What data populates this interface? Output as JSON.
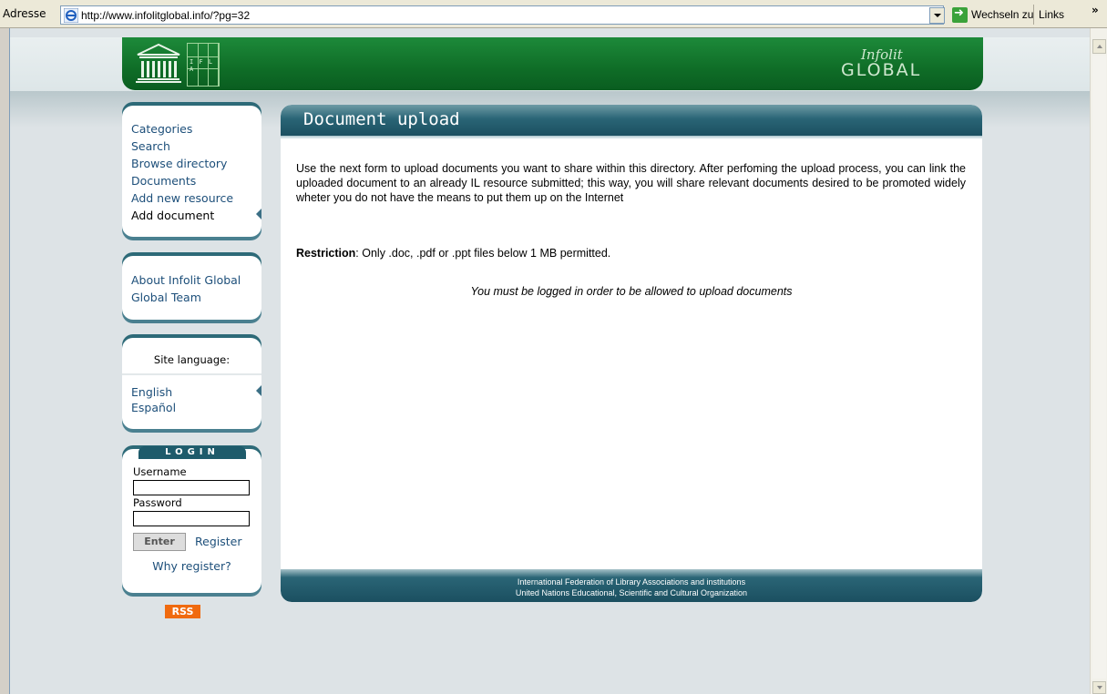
{
  "browser": {
    "address_label": "Adresse",
    "url": "http://www.infolitglobal.info/?pg=32",
    "go_label": "Wechseln zu",
    "links_label": "Links",
    "chevron": "»"
  },
  "logos": {
    "ifla": "I F L A",
    "infolit_top": "Infolit",
    "infolit_bottom": "GLOBAL"
  },
  "nav": {
    "items": [
      "Categories",
      "Search",
      "Browse directory",
      "Documents",
      "Add new resource",
      "Add document"
    ],
    "active_index": 5
  },
  "about": {
    "items": [
      "About Infolit Global",
      "Global Team"
    ]
  },
  "language": {
    "title": "Site language:",
    "items": [
      "English",
      "Español"
    ]
  },
  "login": {
    "heading": "LOGIN",
    "username_label": "Username",
    "password_label": "Password",
    "enter_label": "Enter",
    "register_label": "Register",
    "why_label": "Why register?"
  },
  "rss_label": "RSS",
  "main": {
    "title": "Document upload",
    "body": "Use the next form to upload documents you want to share within this directory. After perfoming the upload process, you can link the uploaded document to an already IL resource submitted; this way, you will share relevant documents desired to be promoted widely wheter you do not have the means to put them up on the Internet",
    "restriction_label": "Restriction",
    "restriction_text": ": Only .doc, .pdf or .ppt files below 1 MB permitted.",
    "login_note": "You must be logged in order to be allowed to upload documents",
    "footer_line1": "International Federation of Library Associations and institutions",
    "footer_line2": "United Nations Educational, Scientific and Cultural Organization"
  },
  "colors": {
    "banner_green": "#0f6d27",
    "panel_teal": "#1b4f60",
    "link_blue": "#1d4f7a",
    "rss_orange": "#f06a0f"
  }
}
